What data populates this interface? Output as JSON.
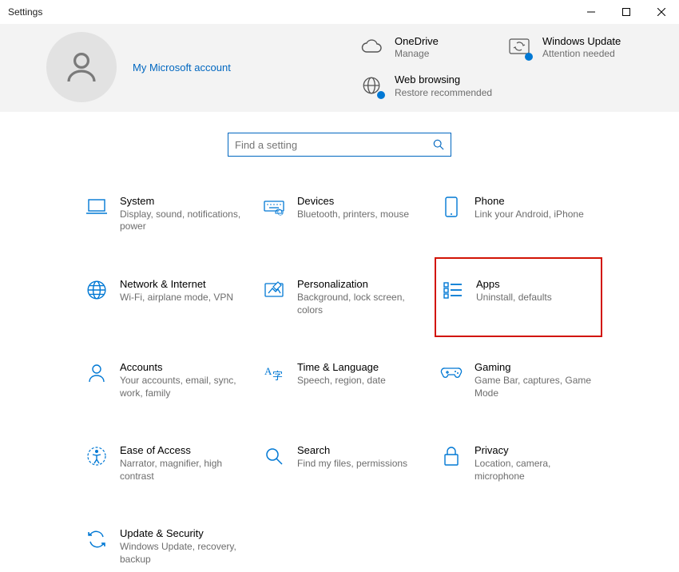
{
  "window": {
    "title": "Settings"
  },
  "header": {
    "account_link": "My Microsoft account",
    "quick": [
      {
        "title": "OneDrive",
        "sub": "Manage"
      },
      {
        "title": "Windows Update",
        "sub": "Attention needed"
      },
      {
        "title": "Web browsing",
        "sub": "Restore recommended"
      }
    ]
  },
  "search": {
    "placeholder": "Find a setting"
  },
  "categories": [
    {
      "title": "System",
      "sub": "Display, sound, notifications, power"
    },
    {
      "title": "Devices",
      "sub": "Bluetooth, printers, mouse"
    },
    {
      "title": "Phone",
      "sub": "Link your Android, iPhone"
    },
    {
      "title": "Network & Internet",
      "sub": "Wi-Fi, airplane mode, VPN"
    },
    {
      "title": "Personalization",
      "sub": "Background, lock screen, colors"
    },
    {
      "title": "Apps",
      "sub": "Uninstall, defaults"
    },
    {
      "title": "Accounts",
      "sub": "Your accounts, email, sync, work, family"
    },
    {
      "title": "Time & Language",
      "sub": "Speech, region, date"
    },
    {
      "title": "Gaming",
      "sub": "Game Bar, captures, Game Mode"
    },
    {
      "title": "Ease of Access",
      "sub": "Narrator, magnifier, high contrast"
    },
    {
      "title": "Search",
      "sub": "Find my files, permissions"
    },
    {
      "title": "Privacy",
      "sub": "Location, camera, microphone"
    },
    {
      "title": "Update & Security",
      "sub": "Windows Update, recovery, backup"
    }
  ],
  "highlighted_index": 5
}
